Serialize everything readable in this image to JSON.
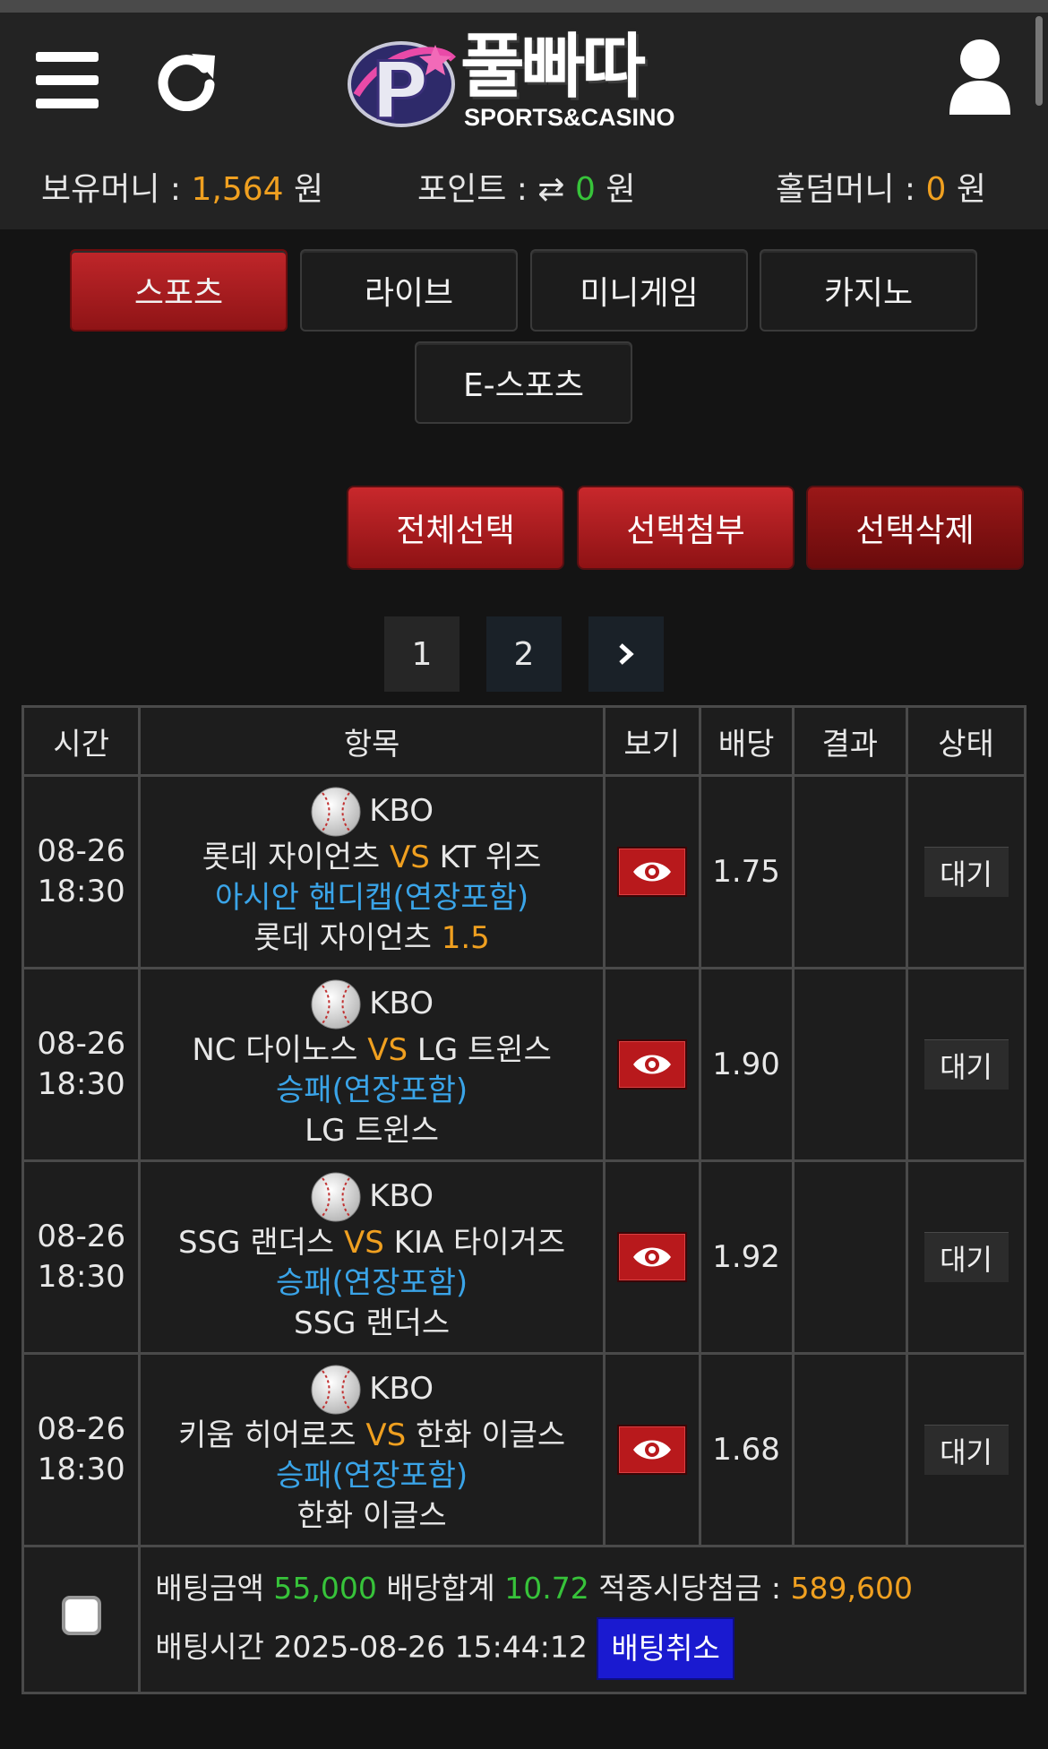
{
  "header": {
    "logo_text": "풀빠따",
    "logo_sub": "SPORTS&CASINO",
    "balance_label": "보유머니 :",
    "balance_value": "1,564",
    "balance_unit": "원",
    "point_label": "포인트 :",
    "point_value": "0",
    "point_unit": "원",
    "holdem_label": "홀덤머니 :",
    "holdem_value": "0",
    "holdem_unit": "원"
  },
  "tabs": [
    {
      "label": "스포츠",
      "active": true
    },
    {
      "label": "라이브",
      "active": false
    },
    {
      "label": "미니게임",
      "active": false
    },
    {
      "label": "카지노",
      "active": false
    },
    {
      "label": "E-스포츠",
      "active": false
    }
  ],
  "actions": {
    "select_all": "전체선택",
    "attach": "선택첨부",
    "delete": "선택삭제"
  },
  "pagination": {
    "pages": [
      "1",
      "2"
    ],
    "current": "1",
    "next_icon": "chevron-right"
  },
  "table": {
    "headers": [
      "시간",
      "항목",
      "보기",
      "배당",
      "결과",
      "상태"
    ],
    "rows": [
      {
        "date": "08-26",
        "time": "18:30",
        "league": "KBO",
        "home": "롯데 자이언츠",
        "vs": "VS",
        "away": "KT 위즈",
        "market": "아시안 핸디캡(연장포함)",
        "pick": "롯데 자이언츠",
        "pick_line": "1.5",
        "odds": "1.75",
        "result": "",
        "status": "대기"
      },
      {
        "date": "08-26",
        "time": "18:30",
        "league": "KBO",
        "home": "NC 다이노스",
        "vs": "VS",
        "away": "LG 트윈스",
        "market": "승패(연장포함)",
        "pick": "LG 트윈스",
        "pick_line": "",
        "odds": "1.90",
        "result": "",
        "status": "대기"
      },
      {
        "date": "08-26",
        "time": "18:30",
        "league": "KBO",
        "home": "SSG 랜더스",
        "vs": "VS",
        "away": "KIA 타이거즈",
        "market": "승패(연장포함)",
        "pick": "SSG 랜더스",
        "pick_line": "",
        "odds": "1.92",
        "result": "",
        "status": "대기"
      },
      {
        "date": "08-26",
        "time": "18:30",
        "league": "KBO",
        "home": "키움 히어로즈",
        "vs": "VS",
        "away": "한화 이글스",
        "market": "승패(연장포함)",
        "pick": "한화 이글스",
        "pick_line": "",
        "odds": "1.68",
        "result": "",
        "status": "대기"
      }
    ]
  },
  "summary": {
    "amount_label": "배팅금액",
    "amount": "55,000",
    "total_odds_label": "배당합계",
    "total_odds": "10.72",
    "payout_label": "적중시당첨금 :",
    "payout": "589,600",
    "bet_time_label": "배팅시간",
    "bet_time": "2025-08-26 15:44:12",
    "cancel_label": "배팅취소"
  },
  "colors": {
    "accent_red": "#c0262a",
    "money_orange": "#f0a020",
    "odds_green": "#37c33a",
    "market_blue": "#3aa4e8",
    "cancel_blue": "#1a1ad0"
  }
}
